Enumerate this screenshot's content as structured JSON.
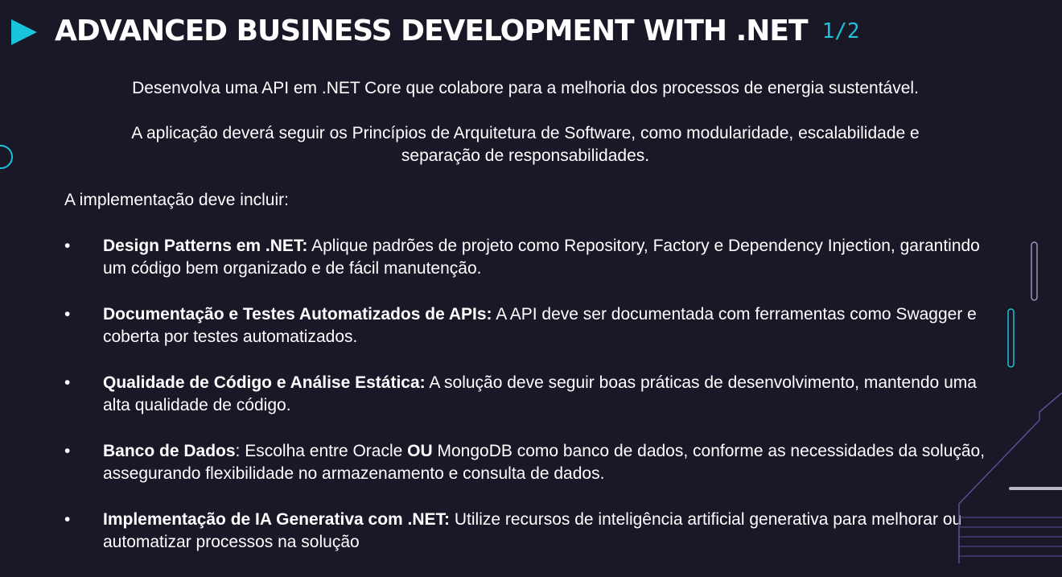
{
  "header": {
    "title": "ADVANCED BUSINESS DEVELOPMENT WITH .NET",
    "page_counter": "1/2"
  },
  "intro": {
    "paragraph_1": "Desenvolva uma API em .NET Core que colabore para a melhoria dos processos de energia sustentável.",
    "paragraph_2_line_1": "A aplicação deverá seguir os Princípios de Arquitetura de Software, como modularidade, escalabilidade e",
    "paragraph_2_line_2": "separação de responsabilidades."
  },
  "requirements": {
    "heading": "A implementação deve incluir:",
    "bullet": "•",
    "items": [
      {
        "title": "Design Patterns em .NET:",
        "text": " Aplique padrões de projeto como Repository, Factory e Dependency Injection, garantindo um código bem organizado e de fácil manutenção."
      },
      {
        "title": "Documentação e Testes Automatizados de APIs:",
        "text": " A API deve ser documentada com ferramentas como Swagger e coberta por testes automatizados."
      },
      {
        "title": "Qualidade de Código e Análise Estática:",
        "text": " A solução deve seguir boas práticas de desenvolvimento, mantendo uma alta qualidade de código."
      },
      {
        "title": "Banco de Dados",
        "text_a": ": Escolha entre Oracle ",
        "emphasis": "OU",
        "text_b": " MongoDB como banco de dados, conforme as necessidades da solução, assegurando flexibilidade no armazenamento e consulta de dados."
      },
      {
        "title": "Implementação de IA Generativa com .NET:",
        "text": " Utilize recursos de inteligência artificial generativa para melhorar ou automatizar processos na solução"
      }
    ]
  },
  "colors": {
    "background": "#1a1727",
    "accent": "#19c3d9",
    "decoration_line": "#5a4f96",
    "text": "#ffffff"
  }
}
